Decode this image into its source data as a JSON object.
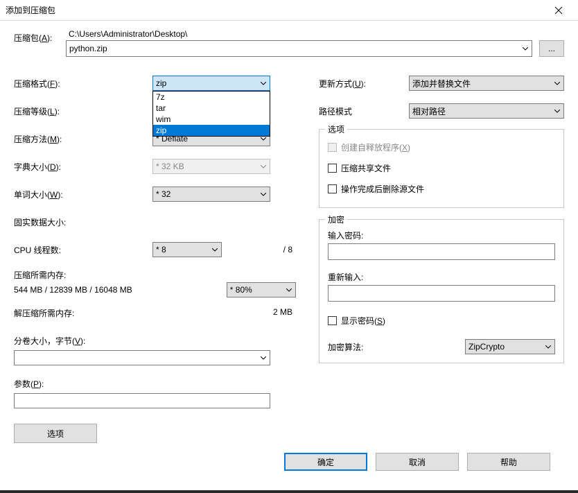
{
  "window": {
    "title": "添加到压缩包",
    "close": "✕"
  },
  "archive": {
    "label": "压缩包(A):",
    "path": "C:\\Users\\Administrator\\Desktop\\",
    "filename": "python.zip",
    "browse": "..."
  },
  "left": {
    "format_label": "压缩格式(F):",
    "format_value": "zip",
    "format_options": [
      "7z",
      "tar",
      "wim",
      "zip"
    ],
    "format_selected_index": 3,
    "level_label": "压缩等级(L):",
    "method_label": "压缩方法(M):",
    "method_value": "* Deflate",
    "dict_label": "字典大小(D):",
    "dict_value": "* 32 KB",
    "word_label": "单词大小(W):",
    "word_value": "* 32",
    "solid_label": "固实数据大小:",
    "cpu_label": "CPU 线程数:",
    "cpu_value": "* 8",
    "cpu_max": "/ 8",
    "mem_label": "压缩所需内存:",
    "mem_value": "544 MB / 12839 MB / 16048 MB",
    "mem_pct": "* 80%",
    "decomp_label": "解压缩所需内存:",
    "decomp_value": "2 MB",
    "volume_label": "分卷大小，字节(V):",
    "params_label": "参数(P):",
    "options_btn": "选项"
  },
  "right": {
    "update_label": "更新方式(U):",
    "update_value": "添加并替换文件",
    "pathmode_label": "路径模式",
    "pathmode_value": "相对路径",
    "options_legend": "选项",
    "opt_sfx": "创建自释放程序(X)",
    "opt_shared": "压缩共享文件",
    "opt_delete": "操作完成后删除源文件",
    "enc_legend": "加密",
    "pw_label": "输入密码:",
    "pw2_label": "重新输入:",
    "show_pw": "显示密码(S)",
    "algo_label": "加密算法:",
    "algo_value": "ZipCrypto"
  },
  "footer": {
    "ok": "确定",
    "cancel": "取消",
    "help": "帮助"
  }
}
